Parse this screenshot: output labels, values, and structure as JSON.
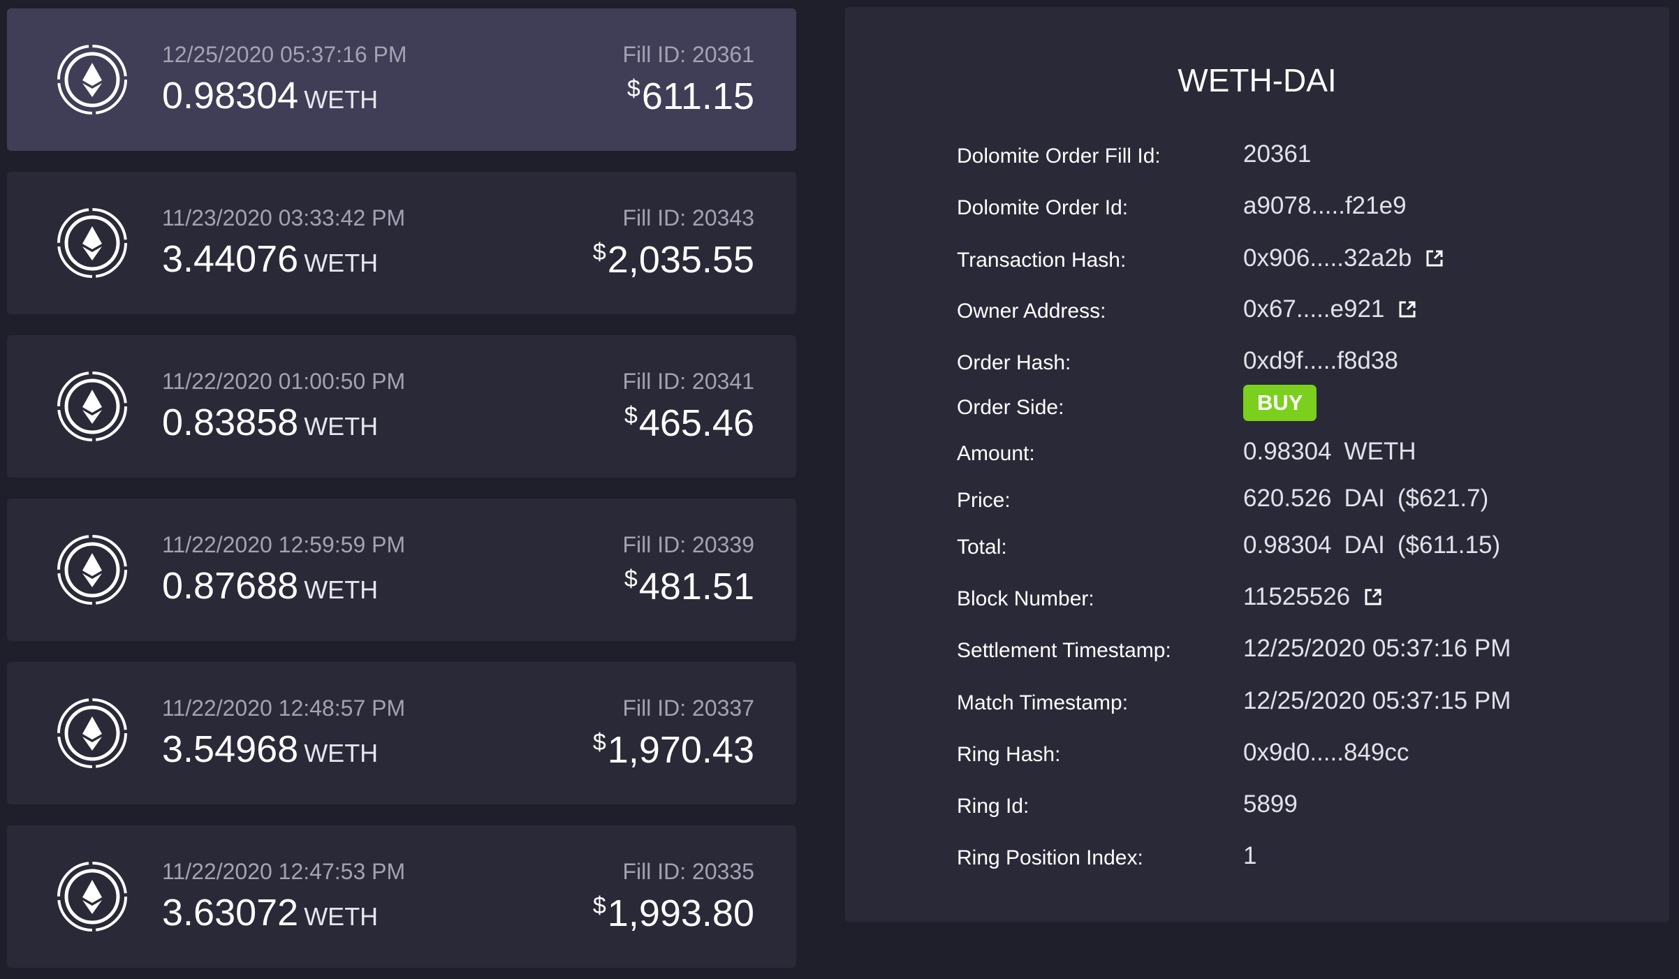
{
  "fills": [
    {
      "date": "12/25/2020 05:37:16 PM",
      "amount": "0.98304",
      "unit": "WETH",
      "fill_id": "Fill ID: 20361",
      "usd_sign": "$",
      "usd": "611.15",
      "selected": true
    },
    {
      "date": "11/23/2020 03:33:42 PM",
      "amount": "3.44076",
      "unit": "WETH",
      "fill_id": "Fill ID: 20343",
      "usd_sign": "$",
      "usd": "2,035.55",
      "selected": false
    },
    {
      "date": "11/22/2020 01:00:50 PM",
      "amount": "0.83858",
      "unit": "WETH",
      "fill_id": "Fill ID: 20341",
      "usd_sign": "$",
      "usd": "465.46",
      "selected": false
    },
    {
      "date": "11/22/2020 12:59:59 PM",
      "amount": "0.87688",
      "unit": "WETH",
      "fill_id": "Fill ID: 20339",
      "usd_sign": "$",
      "usd": "481.51",
      "selected": false
    },
    {
      "date": "11/22/2020 12:48:57 PM",
      "amount": "3.54968",
      "unit": "WETH",
      "fill_id": "Fill ID: 20337",
      "usd_sign": "$",
      "usd": "1,970.43",
      "selected": false
    },
    {
      "date": "11/22/2020 12:47:53 PM",
      "amount": "3.63072",
      "unit": "WETH",
      "fill_id": "Fill ID: 20335",
      "usd_sign": "$",
      "usd": "1,993.80",
      "selected": false
    }
  ],
  "detail": {
    "pair": "WETH-DAI",
    "fill_id_label": "Dolomite Order Fill Id:",
    "fill_id_value": "20361",
    "order_id_label": "Dolomite Order Id:",
    "order_id_value": "a9078.....f21e9",
    "tx_hash_label": "Transaction Hash:",
    "tx_hash_value": "0x906.....32a2b",
    "owner_label": "Owner Address:",
    "owner_value": "0x67.....e921",
    "order_hash_label": "Order Hash:",
    "order_hash_value": "0xd9f.....f8d38",
    "side_label": "Order Side:",
    "side_value": "BUY",
    "amount_label": "Amount:",
    "amount_num": "0.98304",
    "amount_unit": "WETH",
    "price_label": "Price:",
    "price_num": "620.526",
    "price_unit": "DAI",
    "price_usd": "($621.7)",
    "total_label": "Total:",
    "total_num": "0.98304",
    "total_unit": "DAI",
    "total_usd": "($611.15)",
    "block_label": "Block Number:",
    "block_value": "11525526",
    "settlement_label": "Settlement Timestamp:",
    "settlement_value": "12/25/2020 05:37:16 PM",
    "match_label": "Match Timestamp:",
    "match_value": "12/25/2020 05:37:15 PM",
    "ring_hash_label": "Ring Hash:",
    "ring_hash_value": "0x9d0.....849cc",
    "ring_id_label": "Ring Id:",
    "ring_id_value": "5899",
    "ring_pos_label": "Ring Position Index:",
    "ring_pos_value": "1"
  },
  "colors": {
    "background": "#1f1e2b",
    "card": "#2a2938",
    "card_selected": "#3f3e56",
    "buy_badge": "#7ad01c",
    "muted_text": "#a3a3b3"
  },
  "icons": {
    "token": "ethereum-coin-icon",
    "external_link": "external-link-icon"
  }
}
